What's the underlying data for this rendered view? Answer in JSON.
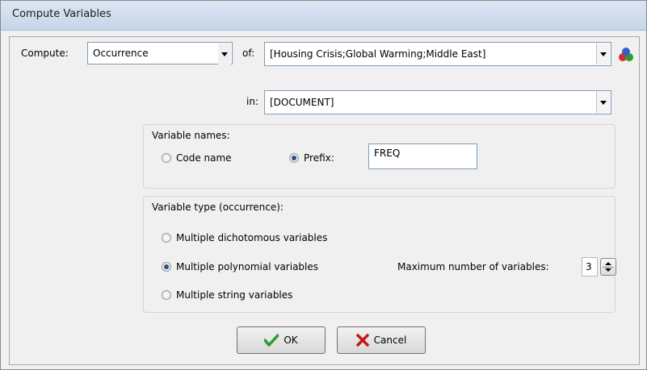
{
  "window": {
    "title": "Compute Variables"
  },
  "compute": {
    "label": "Compute:",
    "selected": "Occurrence"
  },
  "of": {
    "label": "of:",
    "value": "[Housing Crisis;Global Warming;Middle East]"
  },
  "in": {
    "label": "in:",
    "value": "[DOCUMENT]"
  },
  "variable_names": {
    "legend": "Variable names:",
    "code_name_label": "Code name",
    "prefix_label": "Prefix:",
    "prefix_value": "FREQ",
    "selected": "prefix"
  },
  "variable_type": {
    "legend": "Variable type (occurrence):",
    "options": [
      "Multiple dichotomous variables",
      "Multiple polynomial variables",
      "Multiple string variables"
    ],
    "selected_index": 1,
    "max_label": "Maximum number of variables:",
    "max_value": "3"
  },
  "buttons": {
    "ok": "OK",
    "cancel": "Cancel"
  },
  "colors": {
    "title_bar": "#c6d5e8",
    "ok_check": "#2e9b2e",
    "cancel_x": "#c21a1a"
  },
  "icons": {
    "codes": "colored-balls-icon"
  }
}
